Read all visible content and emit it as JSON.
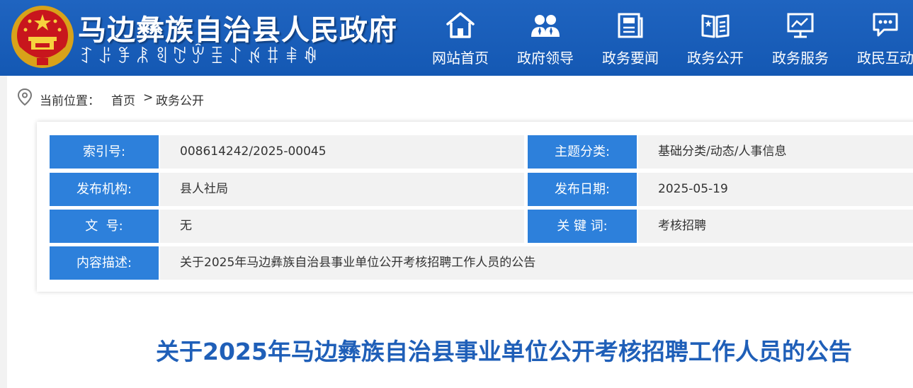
{
  "header": {
    "site_title": "马边彝族自治县人民政府",
    "yi_script": "ꆈꌠꊈꂿꑠꇖꏭꀨꋍꉌꐚꑌꊿ"
  },
  "nav": [
    {
      "label": "网站首页",
      "icon": "home-icon"
    },
    {
      "label": "政府领导",
      "icon": "leaders-icon"
    },
    {
      "label": "政务要闻",
      "icon": "news-icon"
    },
    {
      "label": "政务公开",
      "icon": "book-icon"
    },
    {
      "label": "政务服务",
      "icon": "monitor-icon"
    },
    {
      "label": "政民互动",
      "icon": "chat-icon"
    }
  ],
  "breadcrumb": {
    "label": "当前位置：",
    "home": "首页",
    "separator": ">",
    "current": "政务公开",
    "icon": "location-pin-icon"
  },
  "info": {
    "index_no_key": "索引号:",
    "index_no_value": "008614242/2025-00045",
    "topic_key": "主题分类:",
    "topic_value": "基础分类/动态/人事信息",
    "publisher_key": "发布机构:",
    "publisher_value": "县人社局",
    "date_key": "发布日期:",
    "date_value": "2025-05-19",
    "doc_no_key": "文  号:",
    "doc_no_value": "无",
    "keywords_key": "关 键 词:",
    "keywords_value": "考核招聘",
    "desc_key": "内容描述:",
    "desc_value": "关于2025年马边彝族自治县事业单位公开考核招聘工作人员的公告"
  },
  "article": {
    "title": "关于2025年马边彝族自治县事业单位公开考核招聘工作人员的公告"
  },
  "colors": {
    "header_blue": "#1a5db8",
    "key_blue": "#2d80db",
    "title_blue": "#1f5fb8"
  }
}
